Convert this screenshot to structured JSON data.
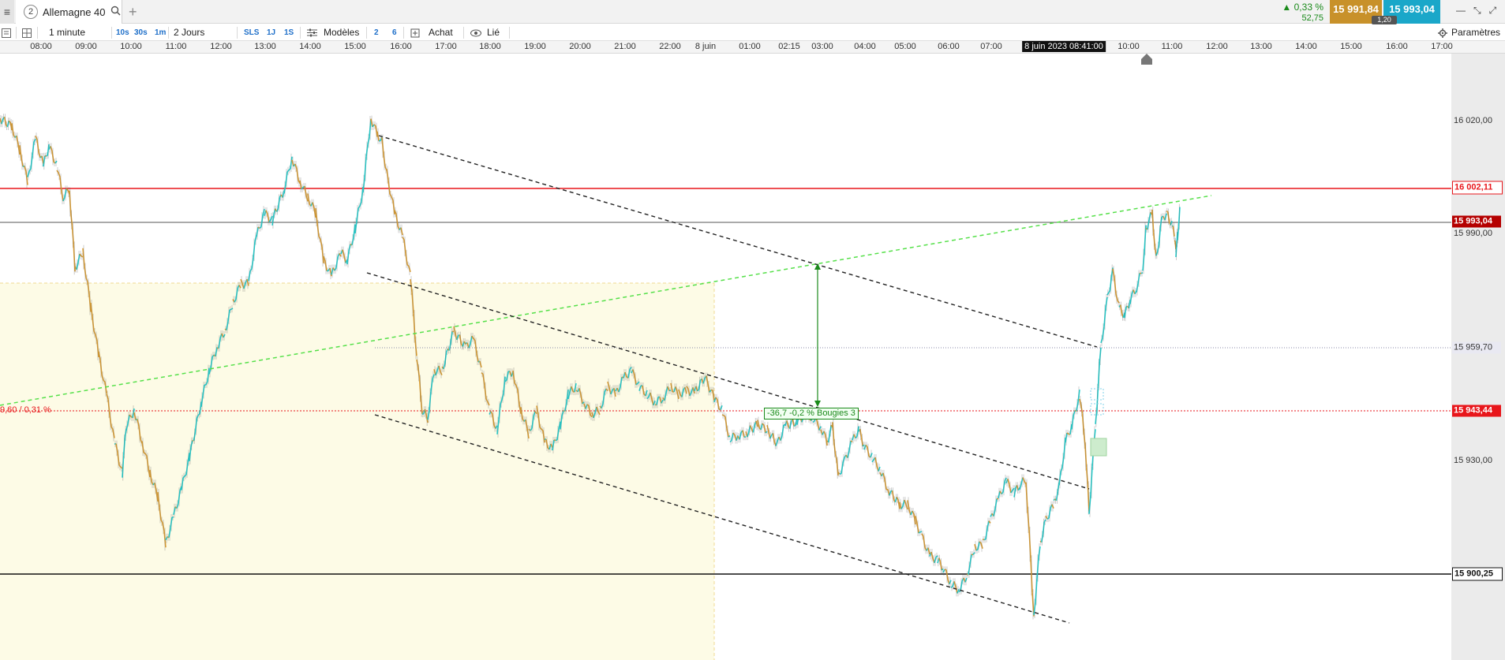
{
  "tabbar": {
    "menu_icon": "hamburger-icon",
    "tab_number": "2",
    "tab_name": "Allemagne 40",
    "search_icon": "magnifier-icon",
    "add_icon": "plus-icon"
  },
  "quote": {
    "change_pct": "▲ 0,33 %",
    "change_pts": "52,75",
    "bid": "15 991,84",
    "ask": "15 993,04",
    "spread": "1,20",
    "bid_color": "#c8912a",
    "ask_color": "#1aa7c9"
  },
  "toolbar": {
    "interval": "1 minute",
    "q10s": "10s",
    "q30s": "30s",
    "q1m": "1m",
    "period": "2 Jours",
    "sls": "SLS",
    "j1": "1J",
    "s1": "1S",
    "models": "Modèles",
    "n2": "2",
    "n6": "6",
    "buy": "Achat",
    "linked": "Lié",
    "settings": "Paramètres"
  },
  "time_axis": {
    "labels": [
      "08:00",
      "09:00",
      "10:00",
      "11:00",
      "12:00",
      "13:00",
      "14:00",
      "15:00",
      "16:00",
      "17:00",
      "18:00",
      "19:00",
      "20:00",
      "21:00",
      "22:00",
      "8 juin",
      "01:00",
      "02:15",
      "03:00",
      "04:00",
      "05:00",
      "06:00",
      "07:00",
      "10:00",
      "11:00",
      "12:00",
      "13:00",
      "14:00",
      "15:00",
      "16:00",
      "17:00"
    ],
    "current": "8 juin 2023 08:41:00"
  },
  "price_axis": {
    "ticks": [
      "16 020,00",
      "15 990,00",
      "15 930,00"
    ],
    "resistance": "16 002,11",
    "last": "15 993,04",
    "dotted_level": "15 959,70",
    "red_level": "15 943,44",
    "support": "15 900,25",
    "left_label": "9,60 / 0,31 %"
  },
  "measure": {
    "label": "-36,7 -0,2 % Bougies 3"
  },
  "colors": {
    "red_line": "#e8161b",
    "green_trend": "#56e04a",
    "candle_up": "#20d4d4",
    "candle_down": "#e0a030",
    "session_bg": "#fdfbe6"
  }
}
